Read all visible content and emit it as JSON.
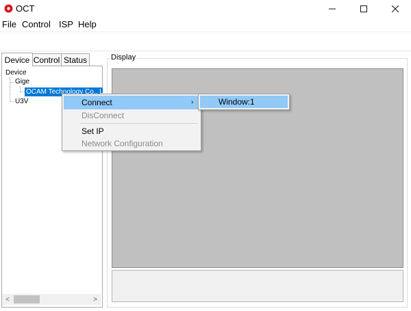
{
  "window": {
    "title": "OCT",
    "controls": {
      "minimize": "—",
      "maximize": "☐",
      "close": "✕"
    }
  },
  "menu": [
    "File",
    "Control",
    "ISP",
    "Help"
  ],
  "tabs": [
    "Device",
    "Control",
    "Status"
  ],
  "tree": {
    "root": "Device",
    "gige": "Gige",
    "ocam": "OCAM Technology Co., Ltd",
    "u3v": "U3V"
  },
  "display": {
    "label": "Display"
  },
  "context_menu": {
    "connect": "Connect",
    "disconnect": "DisConnect",
    "set_ip": "Set IP",
    "network_config": "Network Configuration",
    "submenu_arrow": "›"
  },
  "submenu": {
    "window1": "Window:1"
  },
  "scrollbar": {
    "left_arrow": "<",
    "right_arrow": ">"
  },
  "colors": {
    "selection": "#0078d7",
    "menu_highlight": "#91c9f7",
    "display_bg": "#c0c0c0"
  }
}
